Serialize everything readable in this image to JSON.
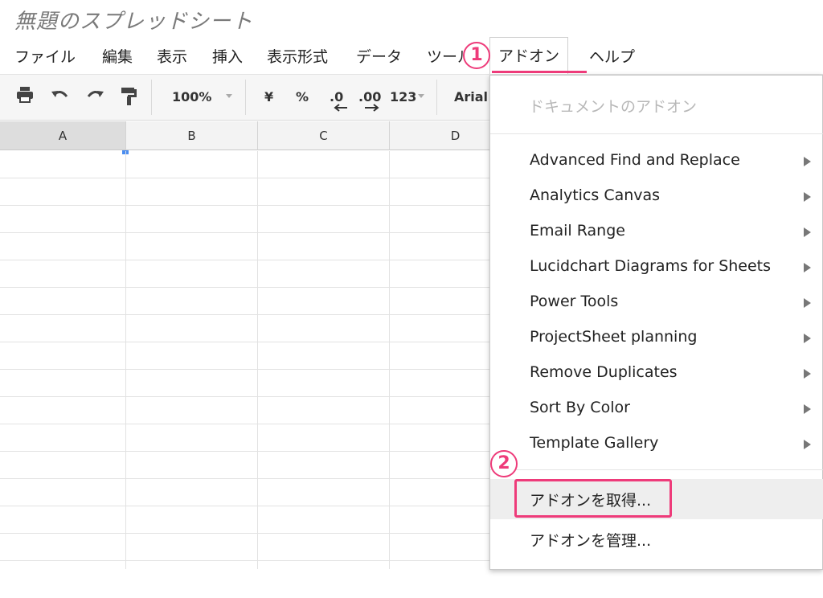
{
  "document": {
    "title": "無題のスプレッドシート"
  },
  "menubar": {
    "items": [
      "ファイル",
      "編集",
      "表示",
      "挿入",
      "表示形式",
      "データ",
      "ツール",
      "アドオン",
      "ヘルプ"
    ],
    "active": "アドオン"
  },
  "toolbar": {
    "print_icon": "printer-icon",
    "undo_icon": "undo-icon",
    "redo_icon": "redo-icon",
    "paint_format_icon": "paint-format-icon",
    "zoom": "100%",
    "currency": "¥",
    "percent": "%",
    "decrease_decimal": ".0",
    "increase_decimal": ".00",
    "number_format": "123",
    "font": "Arial"
  },
  "sheet": {
    "columns": [
      "A",
      "B",
      "C",
      "D"
    ],
    "selected_column": "A"
  },
  "addons_menu": {
    "header": "ドキュメントのアドオン",
    "items": [
      "Advanced Find and Replace",
      "Analytics Canvas",
      "Email Range",
      "Lucidchart Diagrams for Sheets",
      "Power Tools",
      "ProjectSheet planning",
      "Remove Duplicates",
      "Sort By Color",
      "Template Gallery"
    ],
    "get_addons": "アドオンを取得...",
    "manage_addons": "アドオンを管理..."
  },
  "annotations": {
    "step1": "1",
    "step2": "2",
    "color": "#ee3b7a"
  }
}
